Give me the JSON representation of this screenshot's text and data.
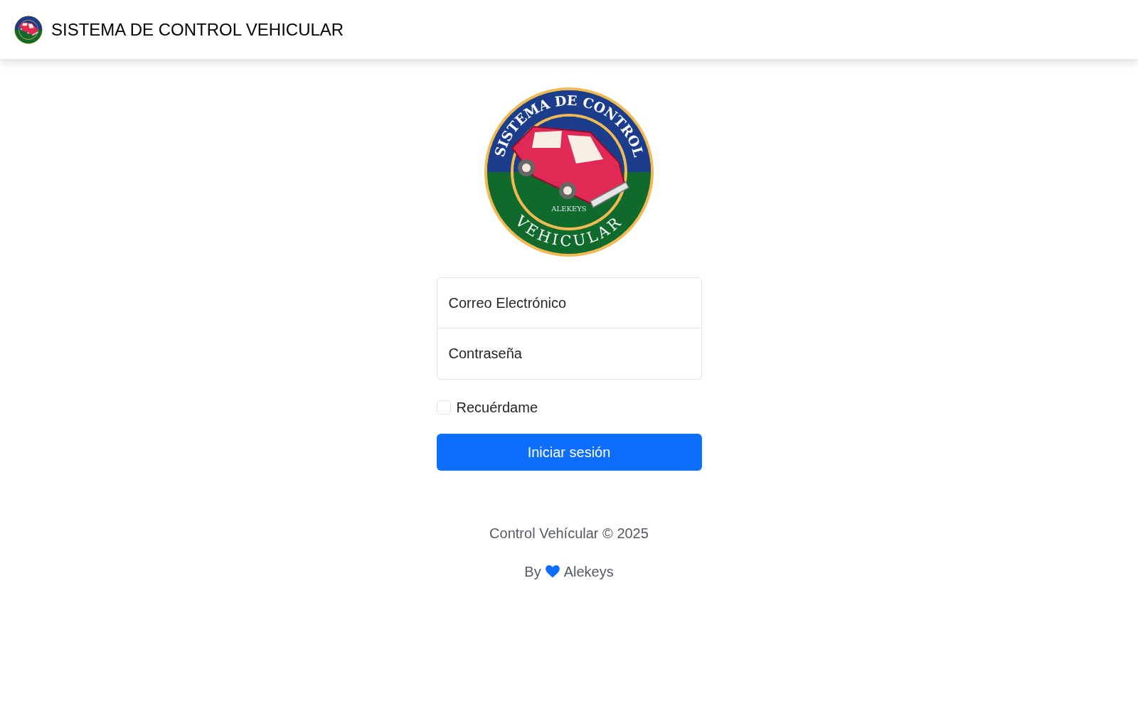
{
  "header": {
    "title": "SISTEMA DE CONTROL VEHICULAR"
  },
  "emblem": {
    "top_text": "SISTEMA DE CONTROL",
    "bottom_text": "VEHICULAR",
    "signature": "ALEKEYS"
  },
  "form": {
    "email": {
      "placeholder": "Correo Electrónico"
    },
    "password": {
      "placeholder": "Contraseña"
    },
    "remember": {
      "label": "Recuérdame",
      "checked": false
    },
    "submit": "Iniciar sesión"
  },
  "footer": {
    "copyright": "Control Vehícular © 2025",
    "by": "By",
    "author": "Alekeys"
  }
}
